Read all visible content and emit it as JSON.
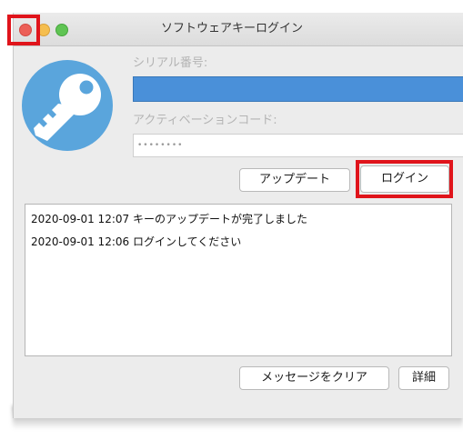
{
  "window": {
    "title": "ソフトウェアキーログイン"
  },
  "form": {
    "serial_label": "シリアル番号:",
    "serial_value": "",
    "activation_label": "アクティベーションコード:",
    "activation_value": "••••••••"
  },
  "buttons": {
    "update": "アップデート",
    "login": "ログイン",
    "clear_messages": "メッセージをクリア",
    "details": "詳細"
  },
  "log": [
    {
      "text": "2020-09-01 12:07 キーのアップデートが完了しました"
    },
    {
      "text": "2020-09-01 12:06 ログインしてください"
    }
  ],
  "icons": {
    "app": "key-icon"
  },
  "colors": {
    "highlight": "#e0141b",
    "accent": "#5aa5dc",
    "serial_field": "#4a90d9",
    "close": "#ec5f57",
    "minimize": "#f5be4f",
    "maximize": "#5fc453"
  }
}
